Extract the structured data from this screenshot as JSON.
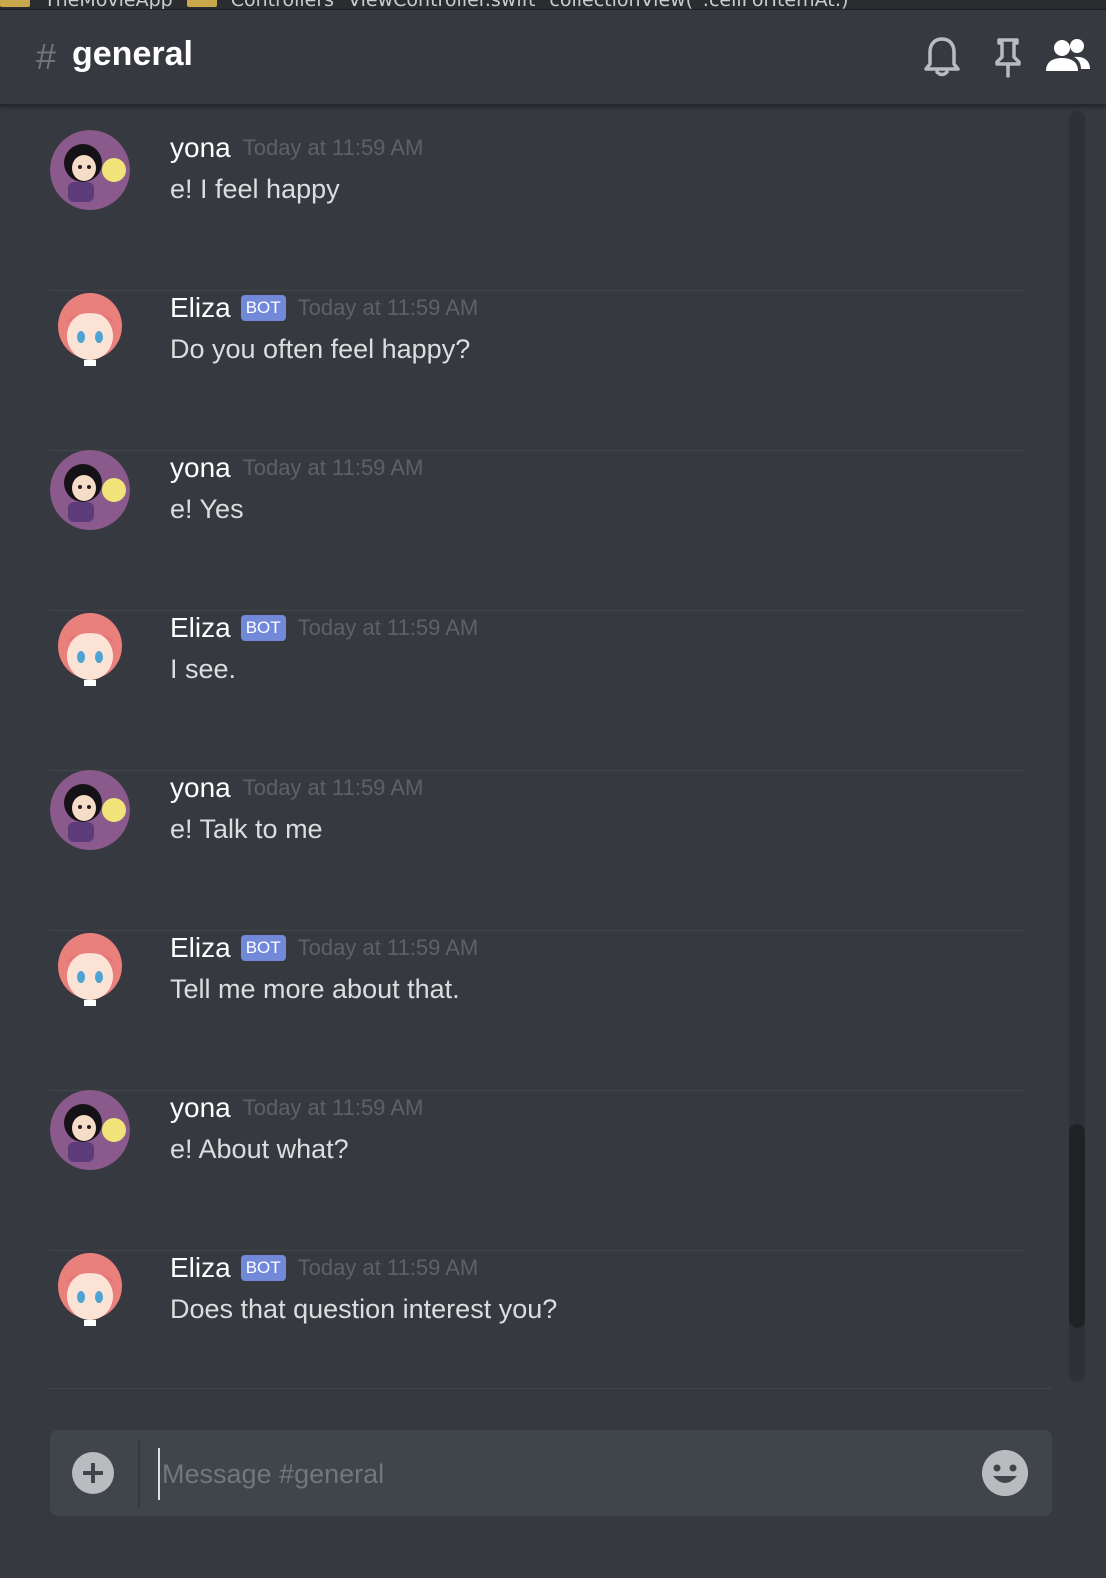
{
  "breadcrumb": {
    "items": [
      "TheMovieApp",
      "Controllers",
      "ViewController.swift",
      "collectionView(_:cellForItemAt:)"
    ]
  },
  "header": {
    "hash": "#",
    "channel_name": "general",
    "icons": [
      "bell-icon",
      "pin-icon",
      "members-icon"
    ]
  },
  "messages": [
    {
      "author": "yona",
      "bot": false,
      "time": "Today at 11:59 AM",
      "text": "e! I feel happy"
    },
    {
      "author": "Eliza",
      "bot": true,
      "bot_label": "BOT",
      "time": "Today at 11:59 AM",
      "text": "Do you often feel happy?"
    },
    {
      "author": "yona",
      "bot": false,
      "time": "Today at 11:59 AM",
      "text": "e! Yes"
    },
    {
      "author": "Eliza",
      "bot": true,
      "bot_label": "BOT",
      "time": "Today at 11:59 AM",
      "text": "I see."
    },
    {
      "author": "yona",
      "bot": false,
      "time": "Today at 11:59 AM",
      "text": "e! Talk to me"
    },
    {
      "author": "Eliza",
      "bot": true,
      "bot_label": "BOT",
      "time": "Today at 11:59 AM",
      "text": "Tell me more about that."
    },
    {
      "author": "yona",
      "bot": false,
      "time": "Today at 11:59 AM",
      "text": "e! About what?"
    },
    {
      "author": "Eliza",
      "bot": true,
      "bot_label": "BOT",
      "time": "Today at 11:59 AM",
      "text": "Does that question interest you?"
    }
  ],
  "composer": {
    "placeholder": "Message #general",
    "value": ""
  },
  "colors": {
    "background": "#36393f",
    "bot_tag": "#7289da",
    "timestamp": "#5e6168"
  }
}
